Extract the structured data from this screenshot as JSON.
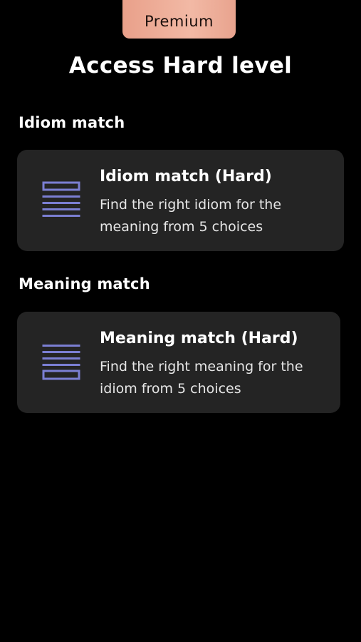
{
  "badge": {
    "label": "Premium"
  },
  "title": "Access Hard level",
  "sections": [
    {
      "heading": "Idiom match",
      "card": {
        "icon": "list-top-box-icon",
        "title": "Idiom match (Hard)",
        "description": "Find the right idiom for the meaning from 5 choices"
      }
    },
    {
      "heading": "Meaning match",
      "card": {
        "icon": "list-bottom-box-icon",
        "title": "Meaning match (Hard)",
        "description": "Find the right meaning for the idiom from 5 choices"
      }
    }
  ],
  "colors": {
    "background": "#000000",
    "card": "#242424",
    "icon": "#7b7fd3",
    "badge": "#eeb19c"
  }
}
